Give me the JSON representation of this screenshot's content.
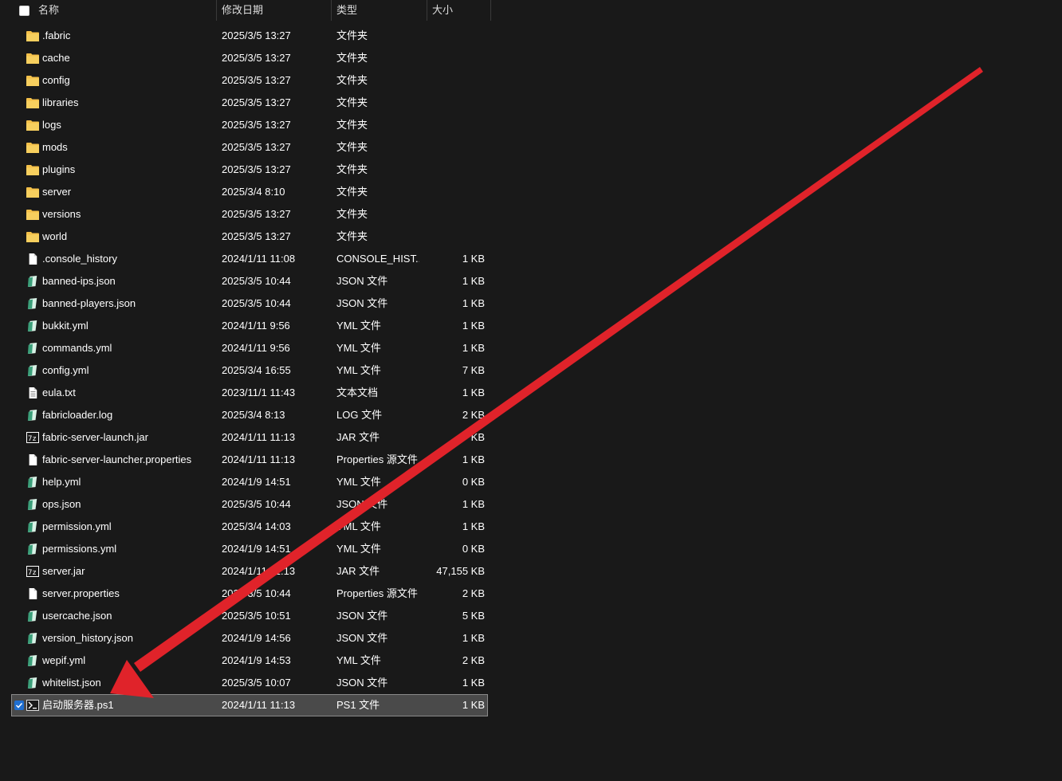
{
  "columns": {
    "name": "名称",
    "date": "修改日期",
    "type": "类型",
    "size": "大小"
  },
  "colors": {
    "background": "#191919",
    "selected_row": "#4a4a4a",
    "folder": "#f4c049",
    "json_icon": "#3ba07a",
    "arrow": "#e0232a"
  },
  "files": [
    {
      "name": ".fabric",
      "date": "2025/3/5 13:27",
      "type": "文件夹",
      "size": "",
      "icon": "folder-icon"
    },
    {
      "name": "cache",
      "date": "2025/3/5 13:27",
      "type": "文件夹",
      "size": "",
      "icon": "folder-icon"
    },
    {
      "name": "config",
      "date": "2025/3/5 13:27",
      "type": "文件夹",
      "size": "",
      "icon": "folder-icon"
    },
    {
      "name": "libraries",
      "date": "2025/3/5 13:27",
      "type": "文件夹",
      "size": "",
      "icon": "folder-icon"
    },
    {
      "name": "logs",
      "date": "2025/3/5 13:27",
      "type": "文件夹",
      "size": "",
      "icon": "folder-icon"
    },
    {
      "name": "mods",
      "date": "2025/3/5 13:27",
      "type": "文件夹",
      "size": "",
      "icon": "folder-icon"
    },
    {
      "name": "plugins",
      "date": "2025/3/5 13:27",
      "type": "文件夹",
      "size": "",
      "icon": "folder-icon"
    },
    {
      "name": "server",
      "date": "2025/3/4 8:10",
      "type": "文件夹",
      "size": "",
      "icon": "folder-icon"
    },
    {
      "name": "versions",
      "date": "2025/3/5 13:27",
      "type": "文件夹",
      "size": "",
      "icon": "folder-icon"
    },
    {
      "name": "world",
      "date": "2025/3/5 13:27",
      "type": "文件夹",
      "size": "",
      "icon": "folder-icon"
    },
    {
      "name": ".console_history",
      "date": "2024/1/11 11:08",
      "type": "CONSOLE_HIST...",
      "size": "1 KB",
      "icon": "blank-file-icon"
    },
    {
      "name": "banned-ips.json",
      "date": "2025/3/5 10:44",
      "type": "JSON 文件",
      "size": "1 KB",
      "icon": "json-file-icon"
    },
    {
      "name": "banned-players.json",
      "date": "2025/3/5 10:44",
      "type": "JSON 文件",
      "size": "1 KB",
      "icon": "json-file-icon"
    },
    {
      "name": "bukkit.yml",
      "date": "2024/1/11 9:56",
      "type": "YML 文件",
      "size": "1 KB",
      "icon": "yml-file-icon"
    },
    {
      "name": "commands.yml",
      "date": "2024/1/11 9:56",
      "type": "YML 文件",
      "size": "1 KB",
      "icon": "yml-file-icon"
    },
    {
      "name": "config.yml",
      "date": "2025/3/4 16:55",
      "type": "YML 文件",
      "size": "7 KB",
      "icon": "yml-file-icon"
    },
    {
      "name": "eula.txt",
      "date": "2023/11/1 11:43",
      "type": "文本文档",
      "size": "1 KB",
      "icon": "text-file-icon"
    },
    {
      "name": "fabricloader.log",
      "date": "2025/3/4 8:13",
      "type": "LOG 文件",
      "size": "2 KB",
      "icon": "log-file-icon"
    },
    {
      "name": "fabric-server-launch.jar",
      "date": "2024/1/11 11:13",
      "type": "JAR 文件",
      "size": "KB",
      "icon": "jar-file-icon"
    },
    {
      "name": "fabric-server-launcher.properties",
      "date": "2024/1/11 11:13",
      "type": "Properties 源文件",
      "size": "1 KB",
      "icon": "blank-file-icon"
    },
    {
      "name": "help.yml",
      "date": "2024/1/9 14:51",
      "type": "YML 文件",
      "size": "0 KB",
      "icon": "yml-file-icon"
    },
    {
      "name": "ops.json",
      "date": "2025/3/5 10:44",
      "type": "JSON 文件",
      "size": "1 KB",
      "icon": "json-file-icon"
    },
    {
      "name": "permission.yml",
      "date": "2025/3/4 14:03",
      "type": "YML 文件",
      "size": "1 KB",
      "icon": "yml-file-icon"
    },
    {
      "name": "permissions.yml",
      "date": "2024/1/9 14:51",
      "type": "YML 文件",
      "size": "0 KB",
      "icon": "yml-file-icon"
    },
    {
      "name": "server.jar",
      "date": "2024/1/11 11:13",
      "type": "JAR 文件",
      "size": "47,155 KB",
      "icon": "jar-file-icon"
    },
    {
      "name": "server.properties",
      "date": "2025/3/5 10:44",
      "type": "Properties 源文件",
      "size": "2 KB",
      "icon": "blank-file-icon"
    },
    {
      "name": "usercache.json",
      "date": "2025/3/5 10:51",
      "type": "JSON 文件",
      "size": "5 KB",
      "icon": "json-file-icon"
    },
    {
      "name": "version_history.json",
      "date": "2024/1/9 14:56",
      "type": "JSON 文件",
      "size": "1 KB",
      "icon": "json-file-icon"
    },
    {
      "name": "wepif.yml",
      "date": "2024/1/9 14:53",
      "type": "YML 文件",
      "size": "2 KB",
      "icon": "yml-file-icon"
    },
    {
      "name": "whitelist.json",
      "date": "2025/3/5 10:07",
      "type": "JSON 文件",
      "size": "1 KB",
      "icon": "json-file-icon"
    },
    {
      "name": "启动服务器.ps1",
      "date": "2024/1/11 11:13",
      "type": "PS1 文件",
      "size": "1 KB",
      "icon": "powershell-file-icon",
      "selected": true
    }
  ]
}
